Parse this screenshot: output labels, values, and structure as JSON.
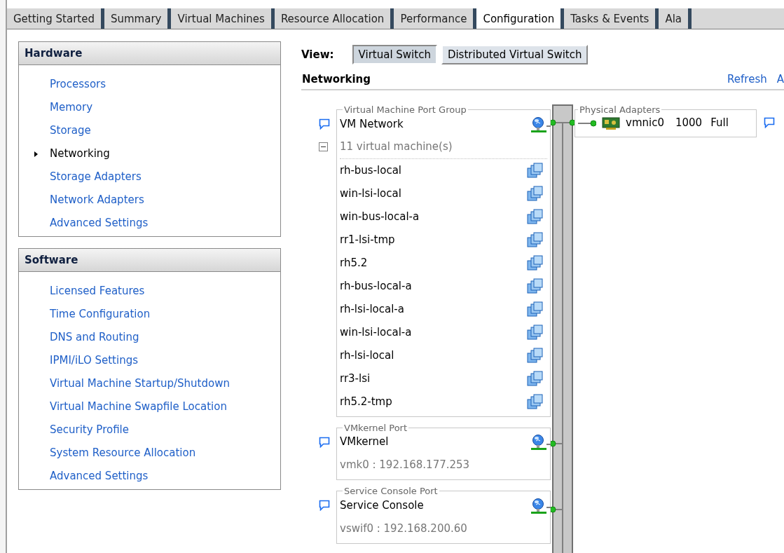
{
  "tabs": [
    {
      "label": "Getting Started",
      "selected": false
    },
    {
      "label": "Summary",
      "selected": false
    },
    {
      "label": "Virtual Machines",
      "selected": false
    },
    {
      "label": "Resource Allocation",
      "selected": false
    },
    {
      "label": "Performance",
      "selected": false
    },
    {
      "label": "Configuration",
      "selected": true
    },
    {
      "label": "Tasks & Events",
      "selected": false
    },
    {
      "label": "Ala",
      "selected": false
    }
  ],
  "hardware": {
    "title": "Hardware",
    "items": [
      {
        "label": "Processors",
        "selected": false
      },
      {
        "label": "Memory",
        "selected": false
      },
      {
        "label": "Storage",
        "selected": false
      },
      {
        "label": "Networking",
        "selected": true
      },
      {
        "label": "Storage Adapters",
        "selected": false
      },
      {
        "label": "Network Adapters",
        "selected": false
      },
      {
        "label": "Advanced Settings",
        "selected": false
      }
    ]
  },
  "software": {
    "title": "Software",
    "items": [
      {
        "label": "Licensed Features",
        "selected": false
      },
      {
        "label": "Time Configuration",
        "selected": false
      },
      {
        "label": "DNS and Routing",
        "selected": false
      },
      {
        "label": "IPMI/iLO Settings",
        "selected": false
      },
      {
        "label": "Virtual Machine Startup/Shutdown",
        "selected": false
      },
      {
        "label": "Virtual Machine Swapfile Location",
        "selected": false
      },
      {
        "label": "Security Profile",
        "selected": false
      },
      {
        "label": "System Resource Allocation",
        "selected": false
      },
      {
        "label": "Advanced Settings",
        "selected": false
      }
    ]
  },
  "view": {
    "label": "View:",
    "options": [
      {
        "label": "Virtual Switch",
        "selected": true
      },
      {
        "label": "Distributed Virtual Switch",
        "selected": false
      }
    ]
  },
  "networking": {
    "title": "Networking",
    "links": [
      "Refresh",
      "A"
    ]
  },
  "port_groups": [
    {
      "kind": "vm",
      "legend": "Virtual Machine Port Group",
      "name": "VM Network",
      "expanded": true,
      "vm_count": "11 virtual machine(s)",
      "vms": [
        "rh-bus-local",
        "win-lsi-local",
        "win-bus-local-a",
        "rr1-lsi-tmp",
        "rh5.2",
        "rh-bus-local-a",
        "rh-lsi-local-a",
        "win-lsi-local-a",
        "rh-lsi-local",
        "rr3-lsi",
        "rh5.2-tmp"
      ]
    },
    {
      "kind": "vmkernel",
      "legend": "VMkernel Port",
      "name": "VMkernel",
      "address": "vmk0 : 192.168.177.253"
    },
    {
      "kind": "console",
      "legend": "Service Console Port",
      "name": "Service Console",
      "address": "vswif0 : 192.168.200.60"
    }
  ],
  "physical_adapters": {
    "legend": "Physical Adapters",
    "adapters": [
      {
        "name": "vmnic0",
        "speed": "1000",
        "duplex": "Full"
      }
    ]
  }
}
